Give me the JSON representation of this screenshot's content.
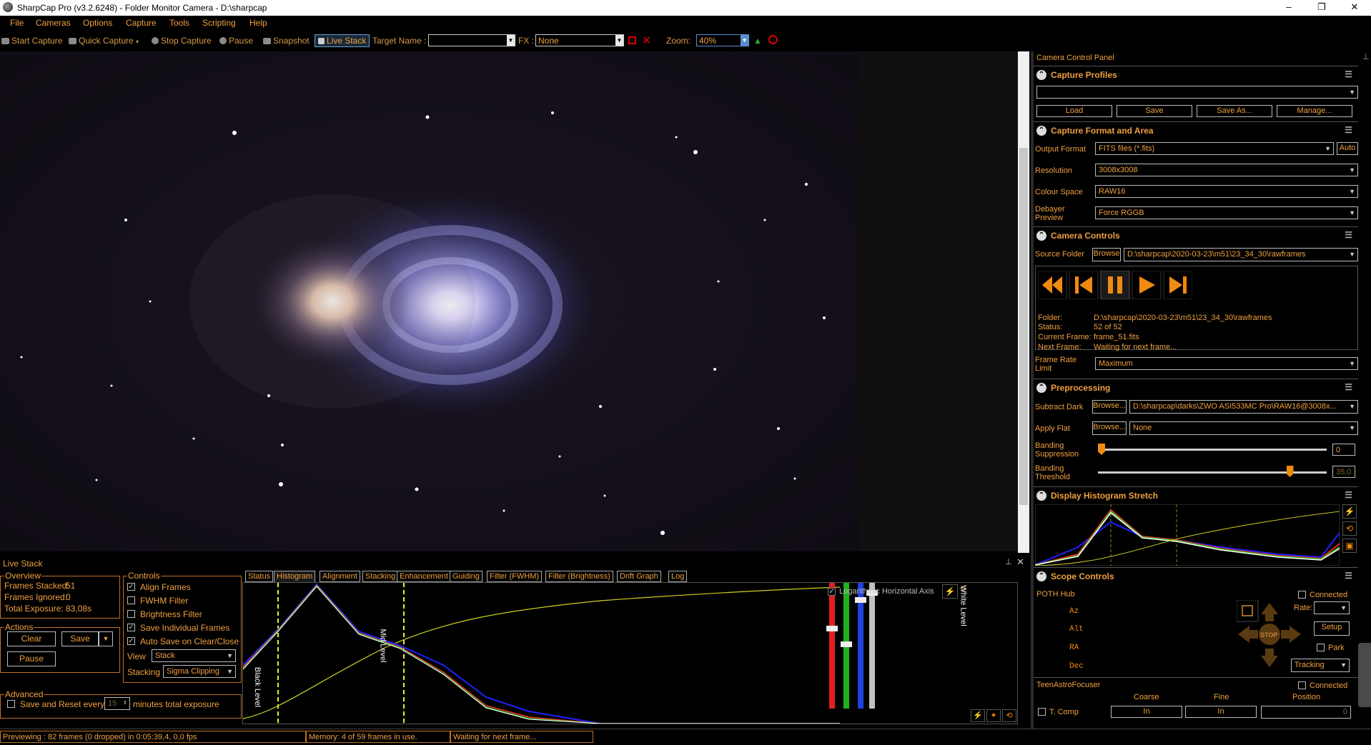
{
  "window": {
    "title": "SharpCap Pro (v3.2.6248) - Folder Monitor Camera - D:\\sharpcap",
    "minimize": "–",
    "maximize": "❐",
    "close": "✕"
  },
  "menu": [
    "File",
    "Cameras",
    "Options",
    "Capture",
    "Tools",
    "Scripting",
    "Help"
  ],
  "toolbar": {
    "start_capture": "Start Capture",
    "quick_capture": "Quick Capture",
    "stop_capture": "Stop Capture",
    "pause": "Pause",
    "snapshot": "Snapshot",
    "live_stack": "Live Stack",
    "target_name_label": "Target Name :",
    "target_name_value": "",
    "fx_label": "FX :",
    "fx_value": "None",
    "zoom_label": "Zoom:",
    "zoom_value": "40%"
  },
  "camera_control_panel": {
    "title": "Camera Control Panel",
    "capture_profiles": {
      "title": "Capture Profiles",
      "profile_value": "",
      "buttons": [
        "Load",
        "Save",
        "Save As...",
        "Manage..."
      ]
    },
    "capture_format": {
      "title": "Capture Format and Area",
      "output_format_label": "Output Format",
      "output_format_value": "FITS files (*.fits)",
      "auto_label": "Auto",
      "resolution_label": "Resolution",
      "resolution_value": "3008x3008",
      "colour_space_label": "Colour Space",
      "colour_space_value": "RAW16",
      "debayer_label_1": "Debayer",
      "debayer_label_2": "Preview",
      "debayer_value": "Force RGGB"
    },
    "camera_controls": {
      "title": "Camera Controls",
      "source_folder_label": "Source Folder",
      "browse_label": "Browse",
      "source_folder_value": "D:\\sharpcap\\2020-03-23\\m51\\23_34_30\\rawframes",
      "info_labels": [
        "Folder:",
        "Status:",
        "Current Frame:",
        "Next Frame:"
      ],
      "info_values": [
        "D:\\sharpcap\\2020-03-23\\m51\\23_34_30\\rawframes",
        "52 of 52",
        "frame_51.fits",
        "Waiting for next frame..."
      ],
      "frame_rate_label_1": "Frame Rate",
      "frame_rate_label_2": "Limit",
      "frame_rate_value": "Maximum"
    },
    "preprocessing": {
      "title": "Preprocessing",
      "subtract_dark_label": "Subtract Dark",
      "subtract_dark_browse": "Browse...",
      "subtract_dark_value": "D:\\sharpcap\\darks\\ZWO ASI533MC Pro\\RAW16@3008x...",
      "apply_flat_label": "Apply Flat",
      "apply_flat_browse": "Browse...",
      "apply_flat_value": "None",
      "banding_suppression_label_1": "Banding",
      "banding_suppression_label_2": "Suppression",
      "banding_suppression_value": "0",
      "banding_suppression_level": 0.0,
      "banding_threshold_label_1": "Banding",
      "banding_threshold_label_2": "Threshold",
      "banding_threshold_value": "35,0",
      "banding_threshold_level": 0.85
    },
    "display_histogram": {
      "title": "Display Histogram Stretch"
    },
    "scope_controls": {
      "title": "Scope Controls",
      "hub_label": "POTH Hub",
      "connected_label": "Connected",
      "rate_label": "Rate:",
      "setup_label": "Setup",
      "park_label": "Park",
      "tracking_label": "Tracking",
      "stop_label": "STOP",
      "axes": [
        "Az",
        "Alt",
        "RA",
        "Dec"
      ]
    },
    "focuser": {
      "name": "TeenAstroFocuser",
      "connected_label": "Connected",
      "coarse_label": "Coarse",
      "fine_label": "Fine",
      "position_label": "Position",
      "t_comp_label": "T. Comp",
      "coarse_in": "In",
      "fine_in": "In",
      "position_value": "0"
    }
  },
  "live_stack": {
    "title": "Live Stack",
    "pin": "⊥",
    "close": "✕",
    "overview": {
      "title": "Overview",
      "frames_stacked_label": "Frames Stacked:",
      "frames_stacked_value": "51",
      "frames_ignored_label": "Frames Ignored:",
      "frames_ignored_value": "0",
      "total_exposure_label": "Total Exposure:",
      "total_exposure_value": "83,08s"
    },
    "actions": {
      "title": "Actions",
      "clear": "Clear",
      "save": "Save",
      "pause": "Pause"
    },
    "advanced": {
      "title": "Advanced",
      "save_reset_label": "Save and Reset every",
      "minutes_value": "15",
      "minutes_label": "minutes total exposure"
    },
    "controls": {
      "title": "Controls",
      "checkboxes": [
        {
          "label": "Align Frames",
          "checked": true
        },
        {
          "label": "FWHM Filter",
          "checked": false
        },
        {
          "label": "Brightness Filter",
          "checked": false
        },
        {
          "label": "Save Individual Frames",
          "checked": true
        },
        {
          "label": "Auto Save on Clear/Close",
          "checked": true
        }
      ],
      "view_label": "View",
      "view_value": "Stack",
      "stacking_label": "Stacking",
      "stacking_value": "Sigma Clipping"
    },
    "tabs": [
      "Status",
      "Histogram",
      "Alignment",
      "Stacking",
      "Enhancement",
      "Guiding",
      "Filter (FWHM)",
      "Filter (Brightness)",
      "Drift Graph",
      "Log"
    ],
    "active_tab": "Histogram",
    "histogram": {
      "log_axis_label": "Logarithmic Horizontal Axis",
      "black_level_label": "Black Level",
      "mid_level_label": "Mid Level",
      "white_level_label": "White Level"
    }
  },
  "status_bar": {
    "previewing": "Previewing : 82 frames (0 dropped) in 0:05:39,4, 0,0 fps",
    "memory": "Memory: 4 of 59 frames in use.",
    "waiting": "Waiting for next frame..."
  },
  "colors": {
    "accent": "#f0a040",
    "background": "#000000",
    "border": "#c07020"
  }
}
